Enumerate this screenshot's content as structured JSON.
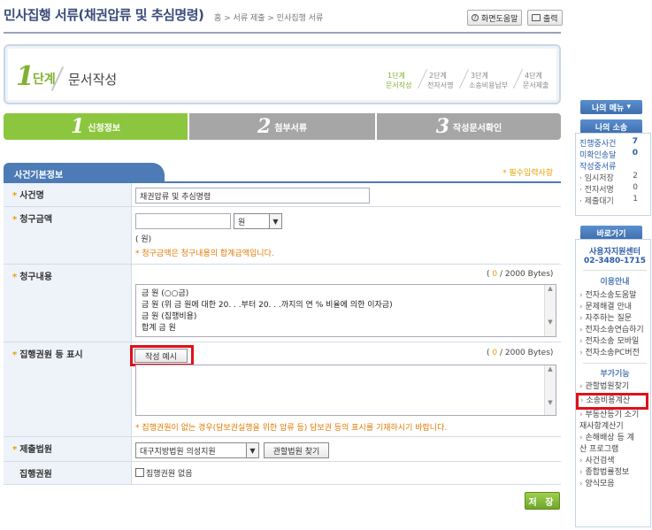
{
  "header": {
    "title": "민사집행 서류(채권압류 및 추심명령)",
    "breadcrumb_home": "홈",
    "breadcrumb_1": "서류 제출",
    "breadcrumb_2": "민사집행 서류",
    "help_button": "화면도움말",
    "print_button": "출력"
  },
  "step": {
    "number": "1",
    "dan": "단계",
    "name": "문서작성",
    "items": [
      {
        "top": "1단계",
        "bottom": "문서작성"
      },
      {
        "top": "2단계",
        "bottom": "전자서명"
      },
      {
        "top": "3단계",
        "bottom": "소송비용납부"
      },
      {
        "top": "4단계",
        "bottom": "문서제출"
      }
    ]
  },
  "tabs": [
    {
      "num": "1",
      "label": "신청정보"
    },
    {
      "num": "2",
      "label": "첨부서류"
    },
    {
      "num": "3",
      "label": "작성문서확인"
    }
  ],
  "section": {
    "title": "사건기본정보",
    "required_note": "* 필수입력사항"
  },
  "form": {
    "case_name_label": "사건명",
    "case_name_value": "채권압류 및 추심명령",
    "claim_amount_label": "청구금액",
    "claim_unit": "원",
    "claim_paren": "( 원)",
    "claim_note": "* 청구금액은 청구내용의 합계금액입니다.",
    "claim_content_label": "청구내용",
    "claim_content_bytes_num": "0",
    "claim_content_bytes_total": "/ 2000 Bytes)",
    "claim_content_lines": [
      "금     원 (○○금)",
      "금     원 (위 금    원에 대한 20.  .  .부터 20.  .  .까지의 연   % 비율에 의한 이자금)",
      "금     원 (집행비용)",
      "합계 금     원"
    ],
    "exec_label": "집행권원 등 표시",
    "exec_example_button": "작성 예시",
    "exec_bytes_num": "0",
    "exec_bytes_total": "/ 2000 Bytes)",
    "exec_note": "* 집행권원이 없는 경우(담보권실행을 위한 압류 등) 담보권 등의 표시를 기재하시기 바랍니다.",
    "court_label": "제출법원",
    "court_value": "대구지방법원 의성지원",
    "court_find_button": "관할법원 찾기",
    "exec_title_label": "집행권원",
    "exec_none_label": "집행권원 없음",
    "save_button": "저 장"
  },
  "sidebar": {
    "my_menu": "나의 메뉴",
    "my_case": "나의 소송",
    "counts": [
      {
        "label": "진행중사건",
        "value": "7"
      },
      {
        "label": "미확인송달",
        "value": "0"
      }
    ],
    "drafting_label": "작성중서류",
    "drafting": [
      {
        "label": "· 임시저장",
        "value": "2"
      },
      {
        "label": "· 전자서명",
        "value": "0"
      },
      {
        "label": "· 제출대기",
        "value": "1"
      }
    ],
    "shortcut": "바로가기",
    "center_name": "사용자지원센터",
    "center_phone": "02-3480-1715",
    "guide_head": "이용안내",
    "guide_items": [
      "전자소송도움말",
      "문제해결 안내",
      "자주하는 질문",
      "전자소송연습하기",
      "전자소송 모바일",
      "전자소송PC버전"
    ],
    "extra_head": "부가기능",
    "extra_items": [
      "관할법원찾기",
      "소송비용계산",
      "부동산등기 소기재사항계산기",
      "손해배상 등 계산 프로그램",
      "사건검색",
      "종합법률정보",
      "양식모음"
    ]
  }
}
